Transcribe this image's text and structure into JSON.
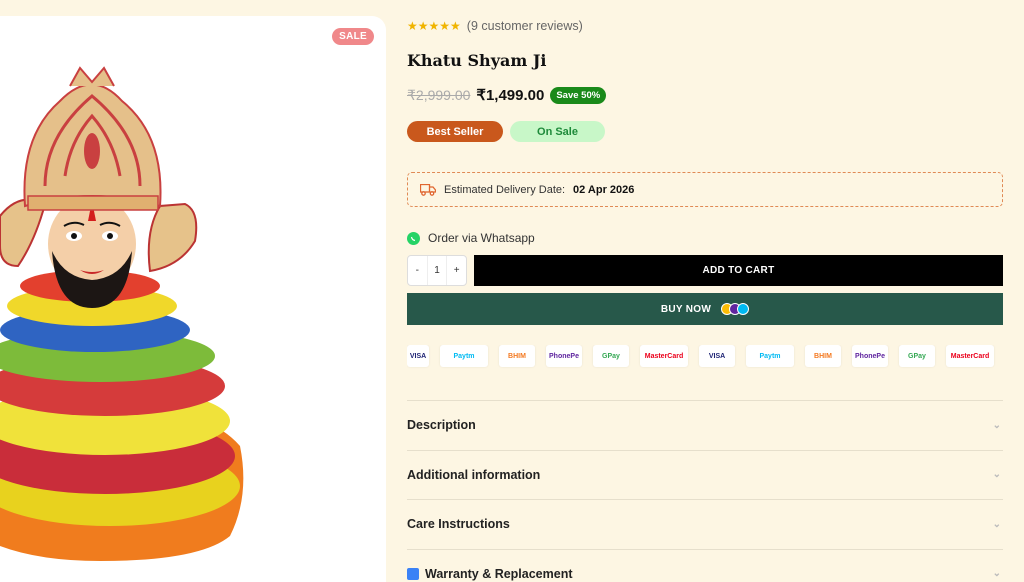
{
  "product": {
    "sale_badge": "SALE",
    "stars": "★★★★★",
    "reviews": "(9 customer reviews)",
    "title": "Khatu Shyam Ji",
    "old_price": "₹2,999.00",
    "new_price": "₹1,499.00",
    "save_badge": "Save 50%",
    "tag_best": "Best Seller",
    "tag_sale": "On Sale"
  },
  "delivery": {
    "label": "Estimated Delivery Date:",
    "date": "02 Apr 2026"
  },
  "whatsapp": {
    "label": "Order via Whatsapp"
  },
  "quantity": {
    "minus": "-",
    "value": "1",
    "plus": "+"
  },
  "buttons": {
    "add_to_cart": "ADD TO CART",
    "buy_now": "BUY NOW"
  },
  "payments": [
    {
      "name": "VISA",
      "color": "#1a1f71"
    },
    {
      "name": "Paytm",
      "color": "#00baf2"
    },
    {
      "name": "BHIM",
      "color": "#f47920"
    },
    {
      "name": "PhonePe",
      "color": "#5f259f"
    },
    {
      "name": "GPay",
      "color": "#34a853"
    },
    {
      "name": "MasterCard",
      "color": "#eb001b"
    },
    {
      "name": "VISA",
      "color": "#1a1f71"
    },
    {
      "name": "Paytm",
      "color": "#00baf2"
    },
    {
      "name": "BHIM",
      "color": "#f47920"
    },
    {
      "name": "PhonePe",
      "color": "#5f259f"
    },
    {
      "name": "GPay",
      "color": "#34a853"
    },
    {
      "name": "MasterCard",
      "color": "#eb001b"
    }
  ],
  "accordion": {
    "description": "Description",
    "additional": "Additional information",
    "care": "Care Instructions",
    "warranty": "Warranty & Replacement"
  },
  "colors": {
    "background": "#fdf6e3",
    "buy_now": "#27584a",
    "best_seller": "#c9581c",
    "save_badge": "#1a8a1a"
  }
}
